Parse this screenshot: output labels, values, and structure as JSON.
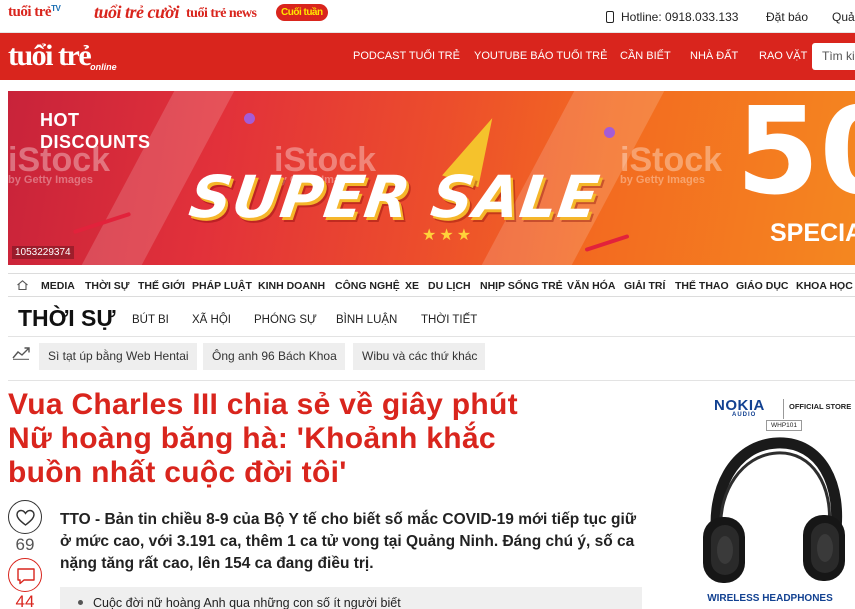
{
  "topbar": {
    "brands": [
      "tuổi trẻ",
      "TV",
      "tuổi trẻ cười",
      "tuổi trẻ news",
      "Cuối tuần"
    ],
    "hotline": "Hotline: 0918.033.133",
    "links": [
      "Đặt báo",
      "Quả"
    ]
  },
  "header": {
    "logo": "tuổi trẻ",
    "logo_sub": "online",
    "nav": [
      "PODCAST TUỔI TRẺ",
      "YOUTUBE BÁO TUỔI TRẺ",
      "CẦN BIẾT",
      "NHÀ ĐẤT",
      "RAO VẶT"
    ],
    "search_placeholder": "Tìm ki"
  },
  "banner": {
    "hot_line1": "HOT",
    "hot_line2": "DISCOUNTS",
    "headline": "SUPER SALE",
    "big": "50",
    "special": "SPECIA",
    "watermark": "iStock",
    "watermark_sub": "by Getty Images",
    "stock_id": "1053229374",
    "stars": "★★★"
  },
  "categories": [
    "MEDIA",
    "THỜI SỰ",
    "THẾ GIỚI",
    "PHÁP LUẬT",
    "KINH DOANH",
    "CÔNG NGHỆ",
    "XE",
    "DU LỊCH",
    "NHỊP SỐNG TRẺ",
    "VĂN HÓA",
    "GIẢI TRÍ",
    "THỂ THAO",
    "GIÁO DỤC",
    "KHOA HỌC"
  ],
  "section": {
    "title": "THỜI SỰ",
    "subs": [
      "BÚT BI",
      "XÃ HỘI",
      "PHÓNG SỰ",
      "BÌNH LUẬN",
      "THỜI TIẾT"
    ]
  },
  "trending": [
    "Sì tạt úp bằng Web Hentai",
    "Ông anh 96 Bách Khoa",
    "Wibu và các thứ khác"
  ],
  "article": {
    "headline_lines": [
      "Vua Charles III chia sẻ về giây phút",
      "Nữ hoàng băng hà: 'Khoảnh khắc",
      "buồn nhất cuộc đời tôi'"
    ],
    "summary": "TTO - Bản tin chiều 8-9 của Bộ Y tế cho biết số mắc COVID-19 mới tiếp tục giữ ở mức cao, với 3.191 ca, thêm 1 ca tử vong tại Quảng Ninh. Đáng chú ý, số ca nặng tăng rất cao, lên 154 ca đang điều trị.",
    "likes": "69",
    "comments": "44",
    "related": "Cuộc đời nữ hoàng Anh qua những con số ít người biết"
  },
  "ad": {
    "brand": "NOKIA",
    "brand_sub": "AUDIO",
    "store": "OFFICIAL STORE",
    "model": "WHP101",
    "caption": "WIRELESS HEADPHONES"
  },
  "colors": {
    "brand_red": "#d9251d",
    "nokia_blue": "#124191"
  }
}
